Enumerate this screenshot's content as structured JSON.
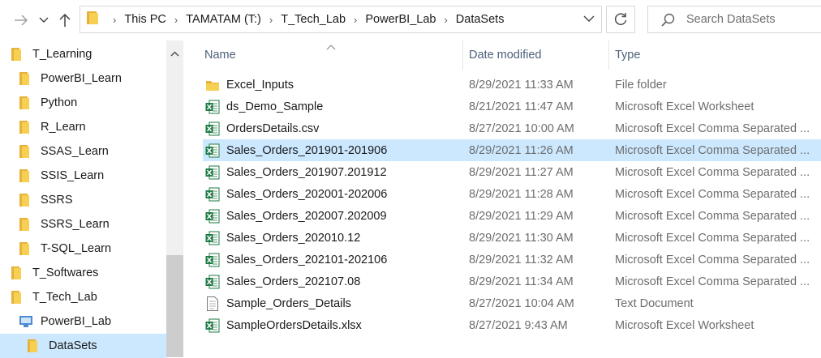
{
  "window": {
    "accent": "#cce8ff"
  },
  "address": {
    "breadcrumbs": [
      "This PC",
      "TAMATAM (T:)",
      "T_Tech_Lab",
      "PowerBI_Lab",
      "DataSets"
    ]
  },
  "search": {
    "placeholder": "Search DataSets"
  },
  "nav": {
    "items": [
      {
        "label": "T_Learning",
        "icon": "folder-icon",
        "indent": 0
      },
      {
        "label": "PowerBI_Learn",
        "icon": "folder-icon",
        "indent": 1
      },
      {
        "label": "Python",
        "icon": "folder-icon",
        "indent": 1
      },
      {
        "label": "R_Learn",
        "icon": "folder-icon",
        "indent": 1
      },
      {
        "label": "SSAS_Learn",
        "icon": "folder-icon",
        "indent": 1
      },
      {
        "label": "SSIS_Learn",
        "icon": "folder-icon",
        "indent": 1
      },
      {
        "label": "SSRS",
        "icon": "folder-icon",
        "indent": 1
      },
      {
        "label": "SSRS_Learn",
        "icon": "folder-icon",
        "indent": 1
      },
      {
        "label": "T-SQL_Learn",
        "icon": "folder-icon",
        "indent": 1
      },
      {
        "label": "T_Softwares",
        "icon": "folder-icon",
        "indent": 0
      },
      {
        "label": "T_Tech_Lab",
        "icon": "folder-icon",
        "indent": 0
      },
      {
        "label": "PowerBI_Lab",
        "icon": "pbi-folder-icon",
        "indent": 1
      },
      {
        "label": "DataSets",
        "icon": "folder-icon",
        "indent": 2,
        "selected": true
      }
    ]
  },
  "columns": {
    "name": "Name",
    "date": "Date modified",
    "type": "Type"
  },
  "files": [
    {
      "name": "Excel_Inputs",
      "date": "8/29/2021 11:33 AM",
      "type": "File folder",
      "icon": "folder-icon"
    },
    {
      "name": "ds_Demo_Sample",
      "date": "8/21/2021 11:47 AM",
      "type": "Microsoft Excel Worksheet",
      "icon": "excel-icon"
    },
    {
      "name": "OrdersDetails.csv",
      "date": "8/27/2021 10:00 AM",
      "type": "Microsoft Excel Comma Separated ...",
      "icon": "excel-icon"
    },
    {
      "name": "Sales_Orders_201901-201906",
      "date": "8/29/2021 11:26 AM",
      "type": "Microsoft Excel Comma Separated ...",
      "icon": "excel-icon",
      "selected": true
    },
    {
      "name": "Sales_Orders_201907.201912",
      "date": "8/29/2021 11:27 AM",
      "type": "Microsoft Excel Comma Separated ...",
      "icon": "excel-icon"
    },
    {
      "name": "Sales_Orders_202001-202006",
      "date": "8/29/2021 11:28 AM",
      "type": "Microsoft Excel Comma Separated ...",
      "icon": "excel-icon"
    },
    {
      "name": "Sales_Orders_202007.202009",
      "date": "8/29/2021 11:29 AM",
      "type": "Microsoft Excel Comma Separated ...",
      "icon": "excel-icon"
    },
    {
      "name": "Sales_Orders_202010.12",
      "date": "8/29/2021 11:30 AM",
      "type": "Microsoft Excel Comma Separated ...",
      "icon": "excel-icon"
    },
    {
      "name": "Sales_Orders_202101-202106",
      "date": "8/29/2021 11:32 AM",
      "type": "Microsoft Excel Comma Separated ...",
      "icon": "excel-icon"
    },
    {
      "name": "Sales_Orders_202107.08",
      "date": "8/29/2021 11:34 AM",
      "type": "Microsoft Excel Comma Separated ...",
      "icon": "excel-icon"
    },
    {
      "name": "Sample_Orders_Details",
      "date": "8/27/2021 10:04 AM",
      "type": "Text Document",
      "icon": "text-document-icon"
    },
    {
      "name": "SampleOrdersDetails.xlsx",
      "date": "8/27/2021 9:43 AM",
      "type": "Microsoft Excel Worksheet",
      "icon": "excel-icon"
    }
  ]
}
